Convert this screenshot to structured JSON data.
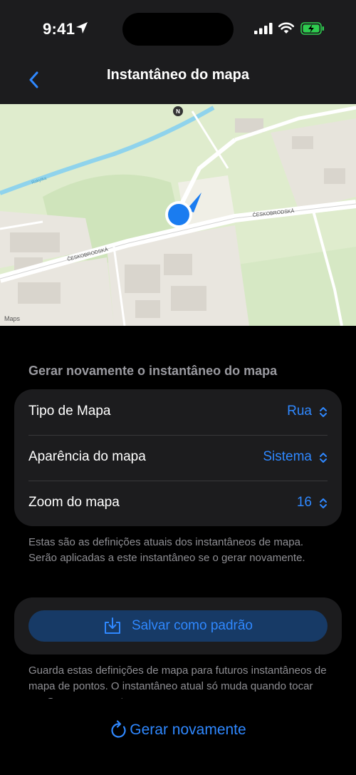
{
  "status": {
    "time": "9:41"
  },
  "nav": {
    "title": "Instantâneo do mapa"
  },
  "map": {
    "brand": "Maps",
    "streets": [
      "ČESKOBRODSKÁ",
      "ČESKOBRODSKÁ",
      "Rokytka"
    ],
    "compass": "N"
  },
  "section": {
    "header": "Gerar novamente o instantâneo do mapa"
  },
  "settings": [
    {
      "label": "Tipo de Mapa",
      "value": "Rua"
    },
    {
      "label": "Aparência do mapa",
      "value": "Sistema"
    },
    {
      "label": "Zoom do mapa",
      "value": "16"
    }
  ],
  "settings_footnote": "Estas são as definições atuais dos instantâneos de mapa. Serão aplicadas a este instantâneo se o gerar novamente.",
  "save": {
    "label": "Salvar como padrão"
  },
  "save_footnote": "Guarda estas definições de mapa para futuros instantâneos de mapa de pontos. O instantâneo atual só muda quando tocar em Gerar novamente.",
  "regenerate": {
    "label": "Gerar novamente"
  },
  "colors": {
    "accent": "#2f88ff",
    "card": "#1c1c1e",
    "button_fill": "#173a66"
  }
}
